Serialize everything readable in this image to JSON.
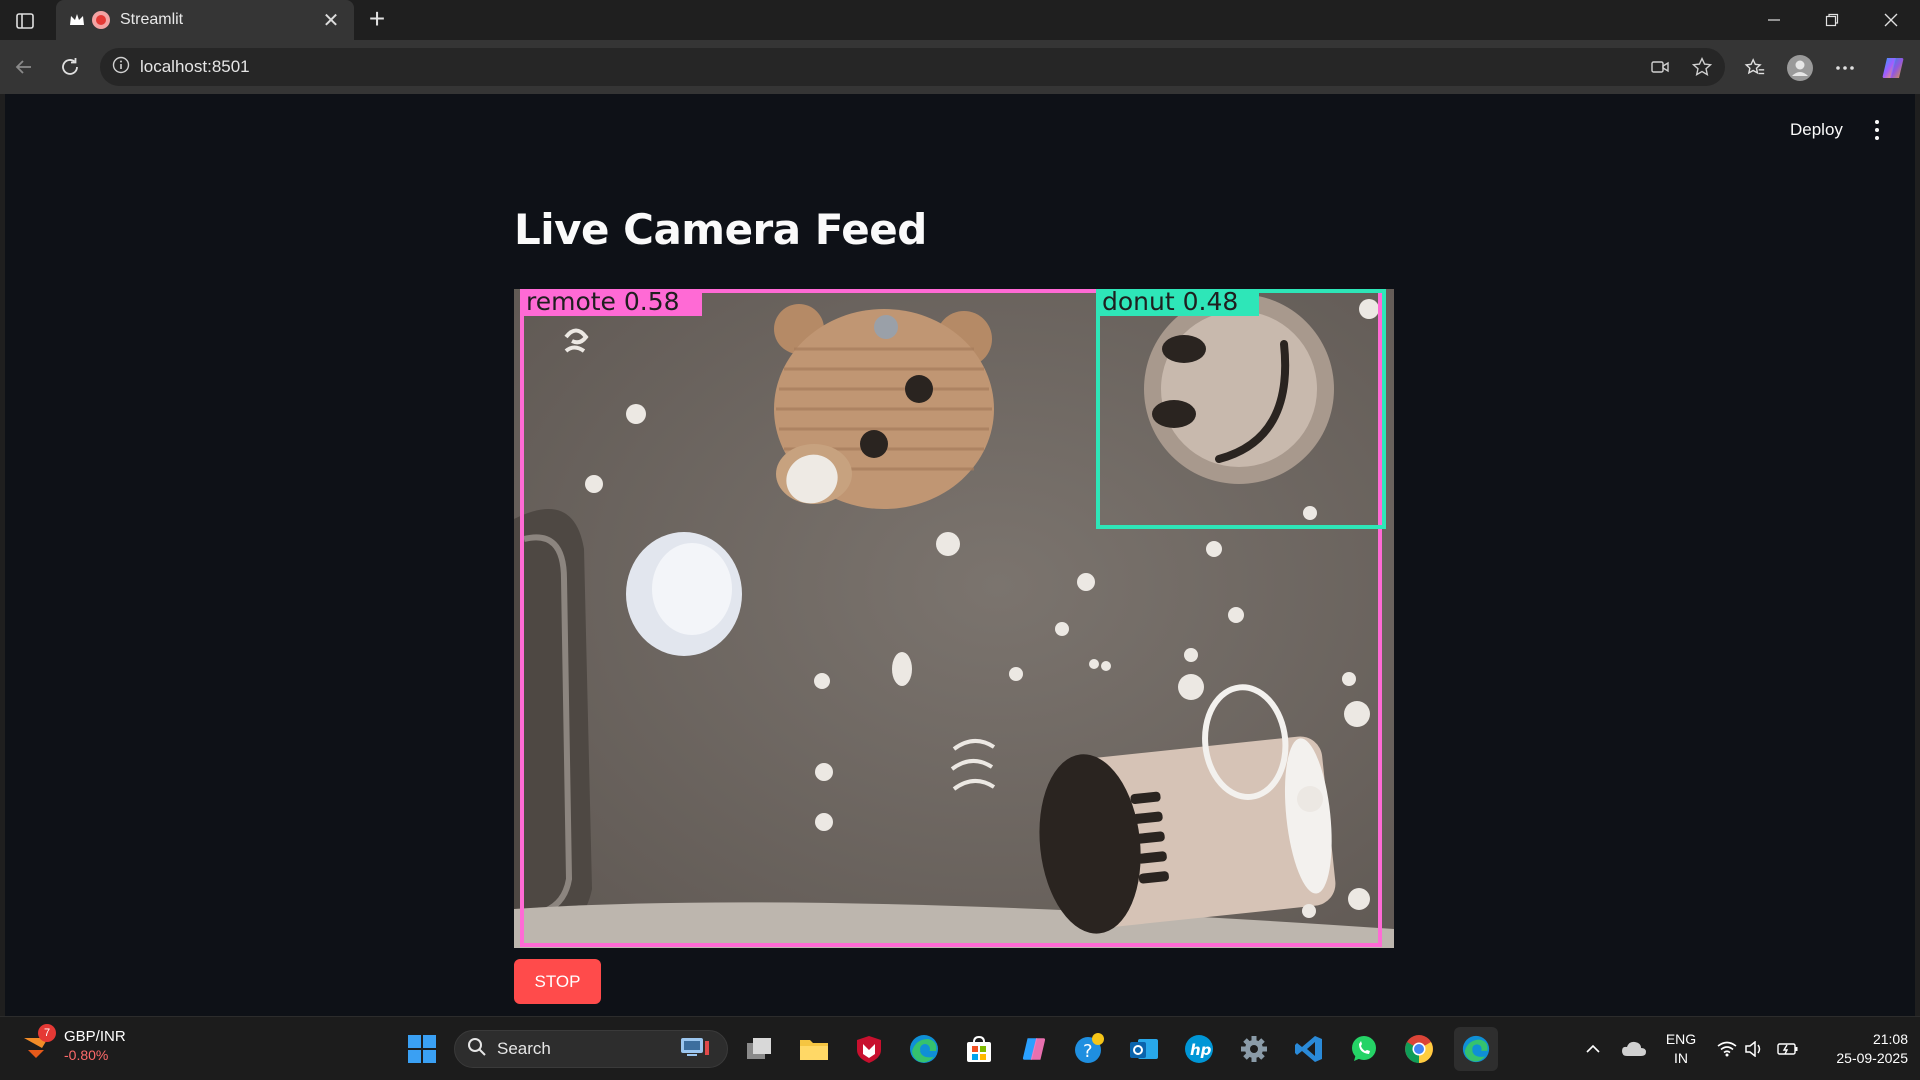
{
  "browser": {
    "tab_title": "Streamlit",
    "url": "localhost:8501"
  },
  "app": {
    "deploy_label": "Deploy",
    "title": "Live Camera Feed",
    "stop_label": "STOP",
    "detections": [
      {
        "label": "remote 0.58",
        "color": "#ff6ad5"
      },
      {
        "label": "donut 0.48",
        "color": "#2ee6b8"
      }
    ]
  },
  "taskbar": {
    "widget": {
      "badge": "7",
      "name": "GBP/INR",
      "change": "-0.80%"
    },
    "search_placeholder": "Search",
    "lang_line1": "ENG",
    "lang_line2": "IN",
    "time": "21:08",
    "date": "25-09-2025"
  },
  "colors": {
    "page_bg": "#0e1117",
    "stop_button": "#ff4b4b",
    "browser_chrome": "#353535"
  }
}
